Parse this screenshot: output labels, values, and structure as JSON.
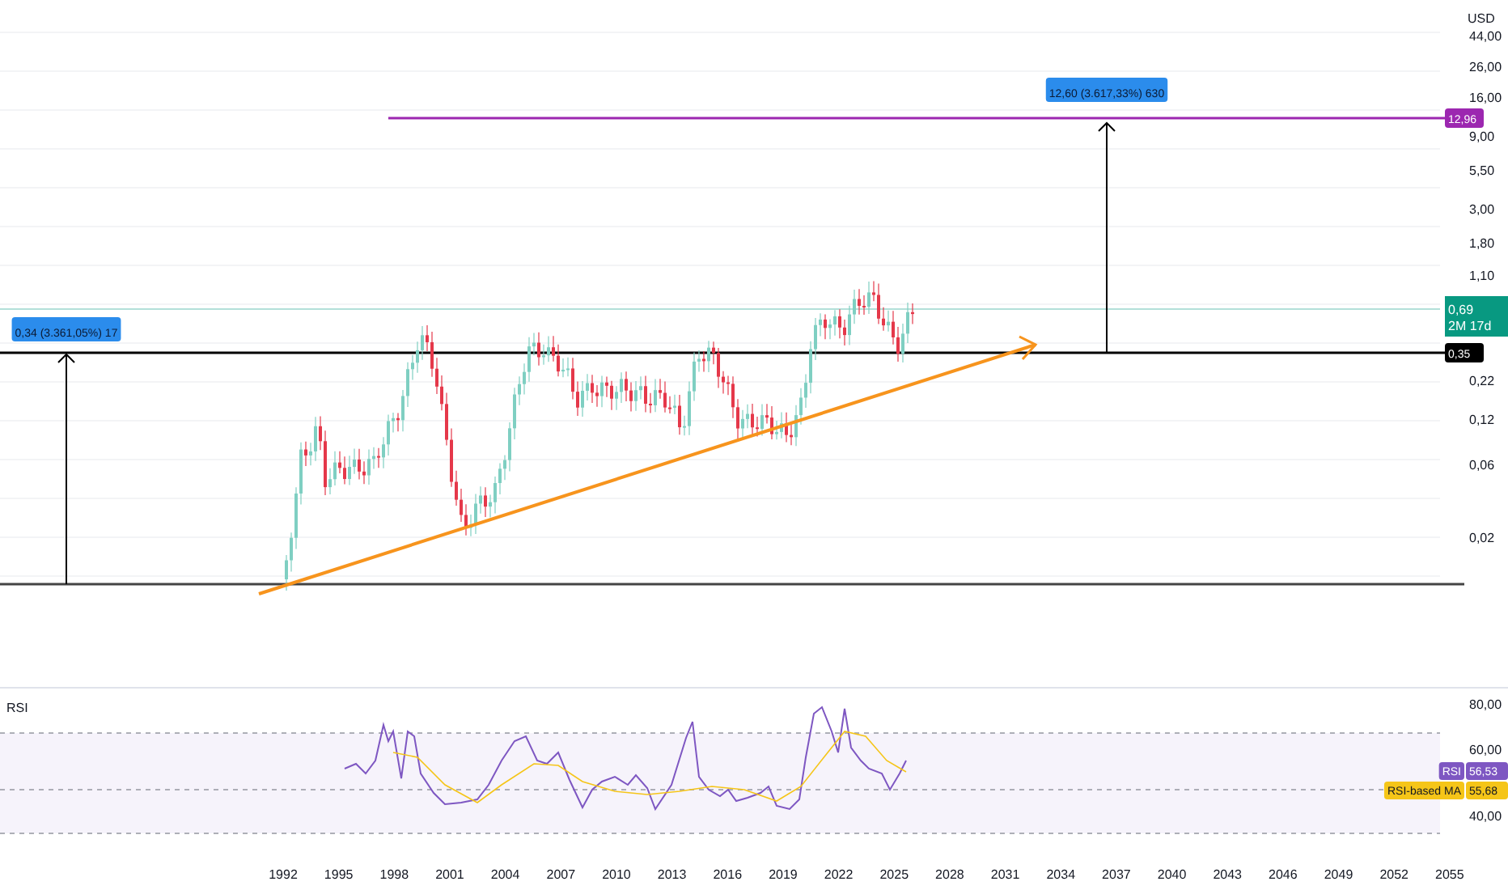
{
  "price_pane": {
    "currency": "USD",
    "scale": [
      "44,00",
      "26,00",
      "16,00",
      "9,00",
      "5,50",
      "3,00",
      "1,80",
      "1,10",
      "0,22",
      "0,12",
      "0,06",
      "0,02"
    ],
    "level_tags": [
      {
        "kind": "target",
        "text": "12,96"
      },
      {
        "kind": "support",
        "text": "0,35"
      }
    ],
    "last_price": {
      "value": "0,69",
      "countdown": "2M 17d"
    },
    "measures": [
      {
        "text": "0,34 (3.361,05%) 17"
      },
      {
        "text": "12,60 (3.617,33%) 630"
      }
    ]
  },
  "rsi_pane": {
    "title": "RSI",
    "scale": [
      "80,00",
      "60,00",
      "40,00"
    ],
    "values": [
      {
        "kind": "rsi",
        "name": "RSI",
        "value": "56,53"
      },
      {
        "kind": "ma",
        "name": "RSI-based MA",
        "value": "55,68"
      }
    ]
  },
  "time_axis": [
    "1992",
    "1995",
    "1998",
    "2001",
    "2004",
    "2007",
    "2010",
    "2013",
    "2016",
    "2019",
    "2022",
    "2025",
    "2028",
    "2031",
    "2034",
    "2037",
    "2040",
    "2043",
    "2046",
    "2049",
    "2052",
    "2055"
  ]
}
